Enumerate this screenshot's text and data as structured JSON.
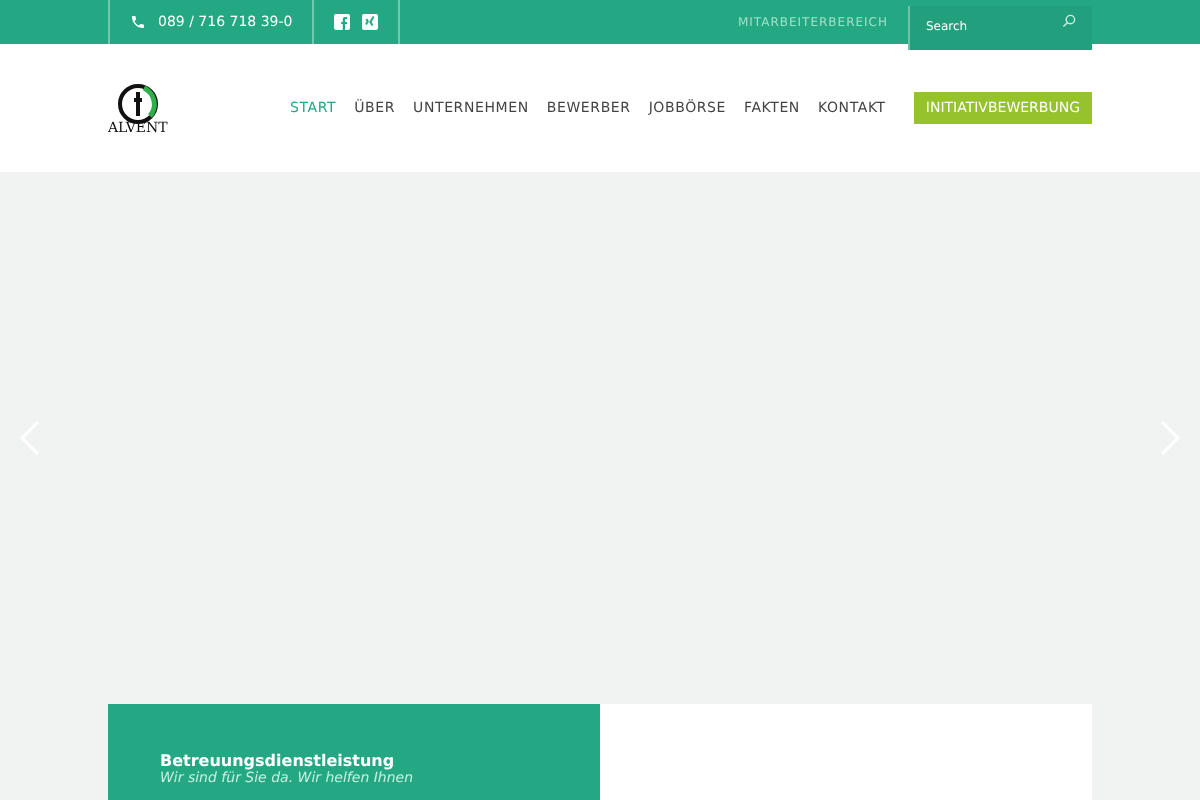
{
  "topbar": {
    "phone": "089 / 716 718 39-0",
    "staff_link": "MITARBEITERBEREICH",
    "search": {
      "placeholder": "Search"
    }
  },
  "header": {
    "logo_text": "ALVENT",
    "nav": [
      {
        "label": "START",
        "selected": true
      },
      {
        "label": "ÜBER",
        "selected": false
      },
      {
        "label": "UNTERNEHMEN",
        "selected": false
      },
      {
        "label": "BEWERBER",
        "selected": false
      },
      {
        "label": "JOBBÖRSE",
        "selected": false
      },
      {
        "label": "FAKTEN",
        "selected": false
      },
      {
        "label": "KONTAKT",
        "selected": false
      }
    ],
    "cta": "INITIATIVBEWERBUNG"
  },
  "card": {
    "title": "Betreuungsdienstleistung",
    "subtitle": "Wir sind für Sie da. Wir helfen Ihnen"
  }
}
